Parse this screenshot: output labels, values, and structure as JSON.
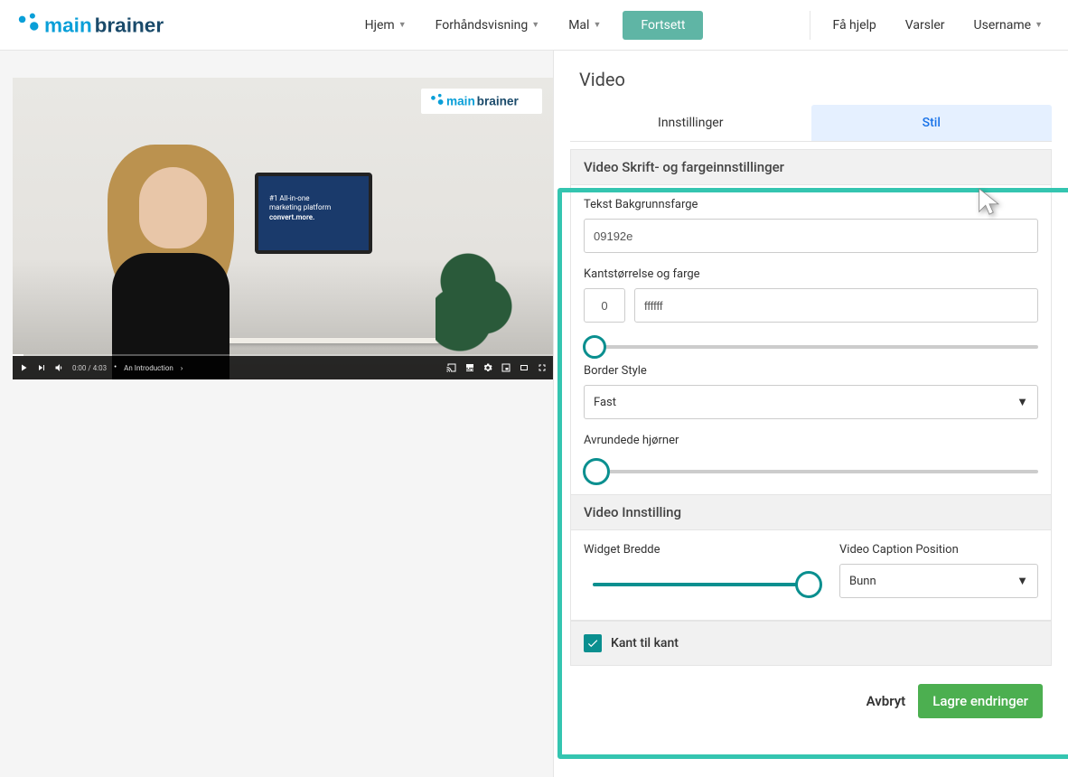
{
  "brand": {
    "name1": "main",
    "name2": "brainer"
  },
  "nav": {
    "hjem": "Hjem",
    "forhands": "Forhåndsvisning",
    "mal": "Mal",
    "fortsett": "Fortsett",
    "hjelp": "Få hjelp",
    "varsler": "Varsler",
    "username": "Username"
  },
  "video_preview": {
    "monitor_line1": "#1 All-in-one",
    "monitor_line2": "marketing platform",
    "monitor_line3": "convert.more.",
    "time": "0:00 / 4:03",
    "title": "An Introduction"
  },
  "panel": {
    "title": "Video",
    "tab_settings": "Innstillinger",
    "tab_style": "Stil"
  },
  "style": {
    "section1_header": "Video Skrift- og fargeinnstillinger",
    "bgcolor_label": "Tekst Bakgrunnsfarge",
    "bgcolor_value": "09192e",
    "border_label": "Kantstørrelse og farge",
    "border_size": "0",
    "border_color": "ffffff",
    "border_style_label": "Border Style",
    "border_style_value": "Fast",
    "rounded_label": "Avrundede hjørner",
    "section2_header": "Video Innstilling",
    "width_label": "Widget Bredde",
    "caption_label": "Video Caption Position",
    "caption_value": "Bunn",
    "edge_label": "Kant til kant"
  },
  "footer": {
    "cancel": "Avbryt",
    "save": "Lagre endringer"
  }
}
